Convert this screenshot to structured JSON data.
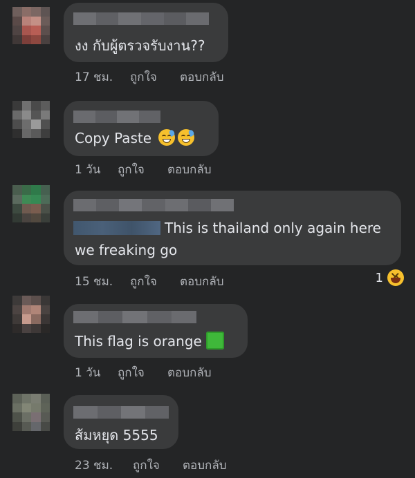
{
  "comments": [
    {
      "text": "งง กับผู้ตรวจรับงาน??",
      "time": "17 ชม.",
      "like": "ถูกใจ",
      "reply": "ตอบกลับ"
    },
    {
      "text": "Copy Paste",
      "emoji": "grinning-sweat-emoji",
      "time": "1 วัน",
      "like": "ถูกใจ",
      "reply": "ตอบกลับ"
    },
    {
      "text_line1": "This is thailand only again here",
      "text_line2": "we freaking go",
      "time": "15 ชม.",
      "like": "ถูกใจ",
      "reply": "ตอบกลับ",
      "reaction_count": "1",
      "reaction_emoji": "laughing-squint-emoji"
    },
    {
      "text": "This flag is orange",
      "emoji": "green-square-emoji",
      "time": "1 วัน",
      "like": "ถูกใจ",
      "reply": "ตอบกลับ"
    },
    {
      "text": "ส้มหยุด 5555",
      "time": "23 ชม.",
      "like": "ถูกใจ",
      "reply": "ตอบกลับ"
    }
  ]
}
